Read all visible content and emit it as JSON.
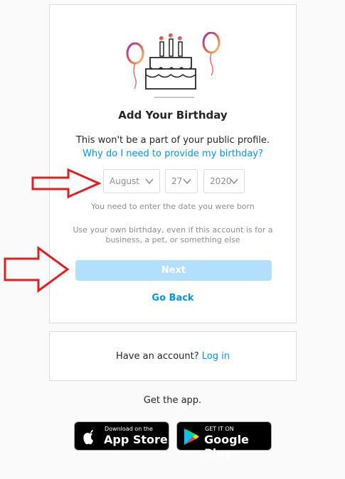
{
  "page": {
    "background": "#fafafa"
  },
  "signup": {
    "title": "Add Your Birthday",
    "subtitle": "This won't be a part of your public profile.",
    "why_link": "Why do I need to provide my birthday?",
    "month": {
      "value": "August"
    },
    "day": {
      "value": "27"
    },
    "year": {
      "value": "2020"
    },
    "hint": "You need to enter the date you were born",
    "note": "Use your own birthday, even if this account is for a business, a pet, or something else",
    "next_label": "Next",
    "back_label": "Go Back"
  },
  "login_box": {
    "text": "Have an account?",
    "link": "Log in"
  },
  "get_app": {
    "label": "Get the app.",
    "app_store": {
      "small": "Download on the",
      "big": "App Store"
    },
    "google_play": {
      "small": "GET IT ON",
      "big": "Google Play"
    }
  },
  "colors": {
    "accent": "#0095f6",
    "disabled_button": "#b2dffc",
    "annotation_arrow": "#e02020"
  }
}
